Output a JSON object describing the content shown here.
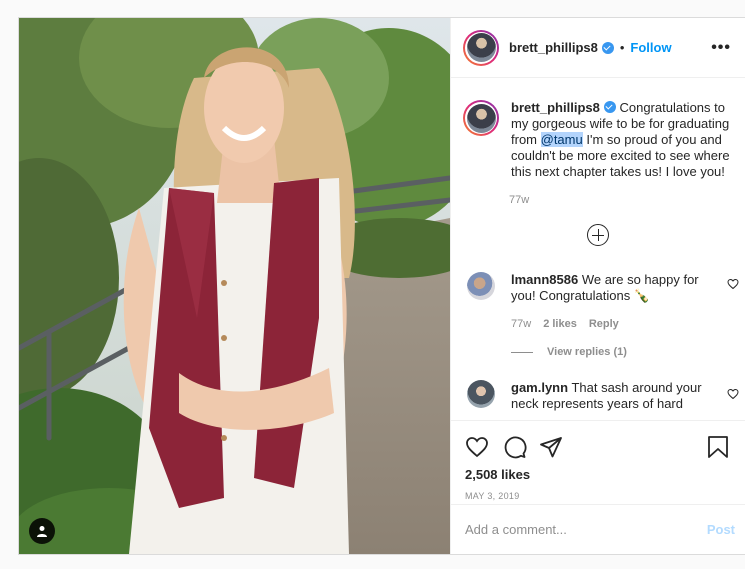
{
  "post": {
    "author": "brett_phillips8",
    "follow_label": "Follow",
    "separator": "•",
    "more_label": "•••"
  },
  "caption": {
    "username": "brett_phillips8",
    "text_before": " Congratulations to my gorgeous wife to be for graduating from ",
    "mention": "@tamu",
    "text_after": " I'm so proud of you and couldn't be more excited to see where this next chapter takes us! I love you!",
    "time": "77w"
  },
  "comments": [
    {
      "username": "lmann8586",
      "text": " We are so happy for you! Congratulations 🍾",
      "time": "77w",
      "likes": "2 likes",
      "reply_label": "Reply",
      "view_replies": "View replies (1)"
    },
    {
      "username": "gam.lynn",
      "text": " That sash around your neck represents years of hard"
    }
  ],
  "actions": {
    "likes_count": "2,508 likes",
    "date": "MAY 3, 2019"
  },
  "add_comment": {
    "placeholder": "Add a comment...",
    "post_label": "Post"
  },
  "colors": {
    "accent": "#0095f6",
    "verified": "#3897f0",
    "sash": "#8c2438"
  }
}
